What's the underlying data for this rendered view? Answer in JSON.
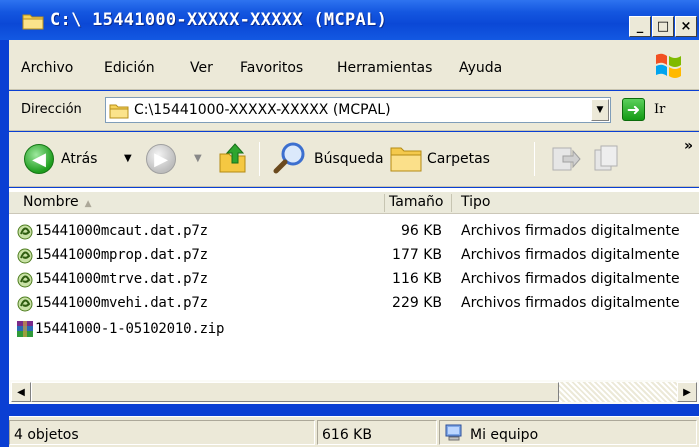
{
  "window": {
    "title": "C:\\ 15441000-XXXXX-XXXXX (MCPAL)",
    "buttons": {
      "minimize": "_",
      "maximize": "□",
      "close": "×"
    }
  },
  "menu": [
    "Archivo",
    "Edición",
    "Ver",
    "Favoritos",
    "Herramientas",
    "Ayuda"
  ],
  "address": {
    "label": "Dirección",
    "value": "C:\\15441000-XXXXX-XXXXX (MCPAL)",
    "go_label": "Ir"
  },
  "toolbar": {
    "back_label": "Atrás",
    "search_label": "Búsqueda",
    "folders_label": "Carpetas",
    "more": "»"
  },
  "columns": {
    "name": "Nombre",
    "size": "Tamaño",
    "type": "Tipo"
  },
  "files": [
    {
      "name": "15441000mcaut.dat.p7z",
      "size": "96 KB",
      "type": "Archivos firmados digitalmente",
      "icon": "signed-file-icon"
    },
    {
      "name": "15441000mprop.dat.p7z",
      "size": "177 KB",
      "type": "Archivos firmados digitalmente",
      "icon": "signed-file-icon"
    },
    {
      "name": "15441000mtrve.dat.p7z",
      "size": "116 KB",
      "type": "Archivos firmados digitalmente",
      "icon": "signed-file-icon"
    },
    {
      "name": "15441000mvehi.dat.p7z",
      "size": "229 KB",
      "type": "Archivos firmados digitalmente",
      "icon": "signed-file-icon"
    },
    {
      "name": "15441000-1-05102010.zip",
      "size": "",
      "type": "",
      "icon": "zip-archive-icon"
    }
  ],
  "status": {
    "objects": "4 objetos",
    "size": "616 KB",
    "location": "Mi equipo"
  }
}
